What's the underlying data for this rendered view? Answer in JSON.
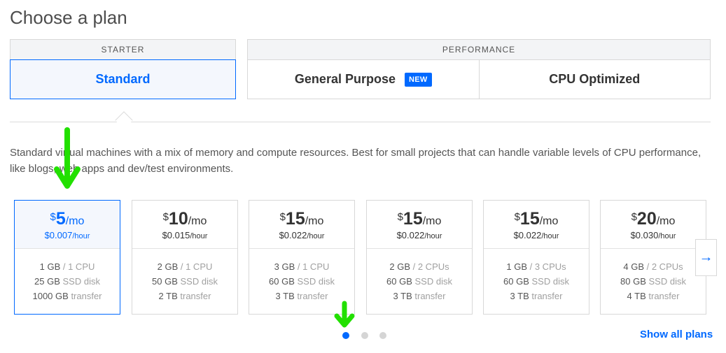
{
  "title": "Choose a plan",
  "groups": {
    "starter": {
      "label": "STARTER"
    },
    "performance": {
      "label": "PERFORMANCE"
    }
  },
  "tabs": [
    {
      "label": "Standard",
      "active": true
    },
    {
      "label": "General Purpose",
      "badge": "NEW",
      "active": false
    },
    {
      "label": "CPU Optimized",
      "active": false
    }
  ],
  "description": "Standard virtual machines with a mix of memory and compute resources. Best for small projects that can handle variable levels of CPU performance, like blogs, web apps and dev/test environments.",
  "plans": [
    {
      "currency": "$",
      "price": "5",
      "per": "/mo",
      "hourly": "$0.007",
      "hourly_unit": "/hour",
      "memory": "1 GB",
      "cpu": "/ 1 CPU",
      "disk": "25 GB",
      "disk_label": "SSD disk",
      "transfer": "1000 GB",
      "transfer_label": "transfer",
      "selected": true
    },
    {
      "currency": "$",
      "price": "10",
      "per": "/mo",
      "hourly": "$0.015",
      "hourly_unit": "/hour",
      "memory": "2 GB",
      "cpu": "/ 1 CPU",
      "disk": "50 GB",
      "disk_label": "SSD disk",
      "transfer": "2 TB",
      "transfer_label": "transfer",
      "selected": false
    },
    {
      "currency": "$",
      "price": "15",
      "per": "/mo",
      "hourly": "$0.022",
      "hourly_unit": "/hour",
      "memory": "3 GB",
      "cpu": "/ 1 CPU",
      "disk": "60 GB",
      "disk_label": "SSD disk",
      "transfer": "3 TB",
      "transfer_label": "transfer",
      "selected": false
    },
    {
      "currency": "$",
      "price": "15",
      "per": "/mo",
      "hourly": "$0.022",
      "hourly_unit": "/hour",
      "memory": "2 GB",
      "cpu": "/ 2 CPUs",
      "disk": "60 GB",
      "disk_label": "SSD disk",
      "transfer": "3 TB",
      "transfer_label": "transfer",
      "selected": false
    },
    {
      "currency": "$",
      "price": "15",
      "per": "/mo",
      "hourly": "$0.022",
      "hourly_unit": "/hour",
      "memory": "1 GB",
      "cpu": "/ 3 CPUs",
      "disk": "60 GB",
      "disk_label": "SSD disk",
      "transfer": "3 TB",
      "transfer_label": "transfer",
      "selected": false
    },
    {
      "currency": "$",
      "price": "20",
      "per": "/mo",
      "hourly": "$0.030",
      "hourly_unit": "/hour",
      "memory": "4 GB",
      "cpu": "/ 2 CPUs",
      "disk": "80 GB",
      "disk_label": "SSD disk",
      "transfer": "4 TB",
      "transfer_label": "transfer",
      "selected": false
    }
  ],
  "carousel": {
    "next_icon": "arrow-right-icon",
    "pages": 3,
    "current_page": 1
  },
  "show_all_label": "Show all plans",
  "colors": {
    "accent": "#0069ff",
    "annotation": "#22e000"
  }
}
